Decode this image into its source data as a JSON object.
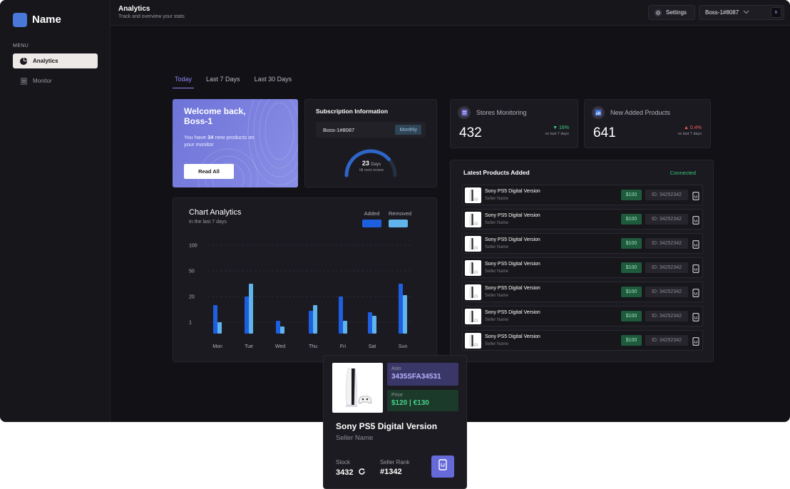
{
  "sidebar": {
    "brand": "Name",
    "menu_label": "MENU",
    "items": [
      {
        "label": "Analytics",
        "icon": "pie-chart-icon",
        "active": true
      },
      {
        "label": "Monitor",
        "icon": "document-icon",
        "active": false
      }
    ]
  },
  "header": {
    "title": "Analytics",
    "subtitle": "Track and overview your stats",
    "settings_label": "Settings",
    "user_label": "Boss-1#8087",
    "avatar_text": "B"
  },
  "tabs": [
    {
      "label": "Today",
      "active": true
    },
    {
      "label": "Last 7 Days",
      "active": false
    },
    {
      "label": "Last 30 Days",
      "active": false
    }
  ],
  "welcome": {
    "title": "Welcome back, Boss-1",
    "text_pre": "You have ",
    "count": "34",
    "text_post": " new products on your monitor",
    "button": "Read All"
  },
  "subscription": {
    "title": "Subscription Information",
    "account": "Boss-1#8087",
    "plan": "Monthly",
    "days_value": "23",
    "days_unit": "Days",
    "days_caption": "till next renew",
    "progress": 0.77
  },
  "stats": [
    {
      "title": "Stores Monitoring",
      "value": "432",
      "change": "▼ 16%",
      "caption": "vs last 7 days",
      "color": "#3ccf86"
    },
    {
      "title": "New Added Products",
      "value": "641",
      "change": "▲ 0.4%",
      "caption": "vs last 7 days",
      "color": "#ef5f5f"
    }
  ],
  "chart": {
    "title": "Chart Analytics",
    "subtitle": "In the last 7 days",
    "legend": [
      {
        "name": "Added",
        "color": "#1e5fe0"
      },
      {
        "name": "Removed",
        "color": "#5fb4ec"
      }
    ]
  },
  "chart_data": {
    "type": "bar",
    "categories": [
      "Mon",
      "Tue",
      "Wed",
      "Thu",
      "Fri",
      "Sat",
      "Sun"
    ],
    "series": [
      {
        "name": "Added",
        "values": [
          40,
          52,
          18,
          32,
          52,
          30,
          70
        ]
      },
      {
        "name": "Removed",
        "values": [
          16,
          70,
          10,
          40,
          18,
          25,
          54
        ]
      }
    ],
    "yticks": [
      "100",
      "50",
      "20",
      "1"
    ],
    "grid": true
  },
  "latest": {
    "title": "Latest Products Added",
    "status": "Connected",
    "rows": [
      {
        "name": "Sony PS5 Digital Version",
        "seller": "Seller Name",
        "price": "$100",
        "id": "ID: 34252342"
      },
      {
        "name": "Sony PS5 Digital Version",
        "seller": "Seller Name",
        "price": "$100",
        "id": "ID: 34252342"
      },
      {
        "name": "Sony PS5 Digital Version",
        "seller": "Seller Name",
        "price": "$100",
        "id": "ID: 34252342"
      },
      {
        "name": "Sony PS5 Digital Version",
        "seller": "Seller Name",
        "price": "$100",
        "id": "ID: 34252342"
      },
      {
        "name": "Sony PS5 Digital Version",
        "seller": "Seller Name",
        "price": "$100",
        "id": "ID: 34252342"
      },
      {
        "name": "Sony PS5 Digital Version",
        "seller": "Seller Name",
        "price": "$100",
        "id": "ID: 34252342"
      },
      {
        "name": "Sony PS5 Digital Version",
        "seller": "Seller Name",
        "price": "$100",
        "id": "ID: 34252342"
      }
    ]
  },
  "popup": {
    "asin_label": "Asin",
    "asin_value": "3435SFA34531",
    "price_label": "Price",
    "price_value": "$120 | €130",
    "name": "Sony PS5 Digital Version",
    "seller": "Seller Name",
    "stock_label": "Stock",
    "stock_value": "3432",
    "rank_label": "Seller Rank",
    "rank_value": "#1342"
  }
}
